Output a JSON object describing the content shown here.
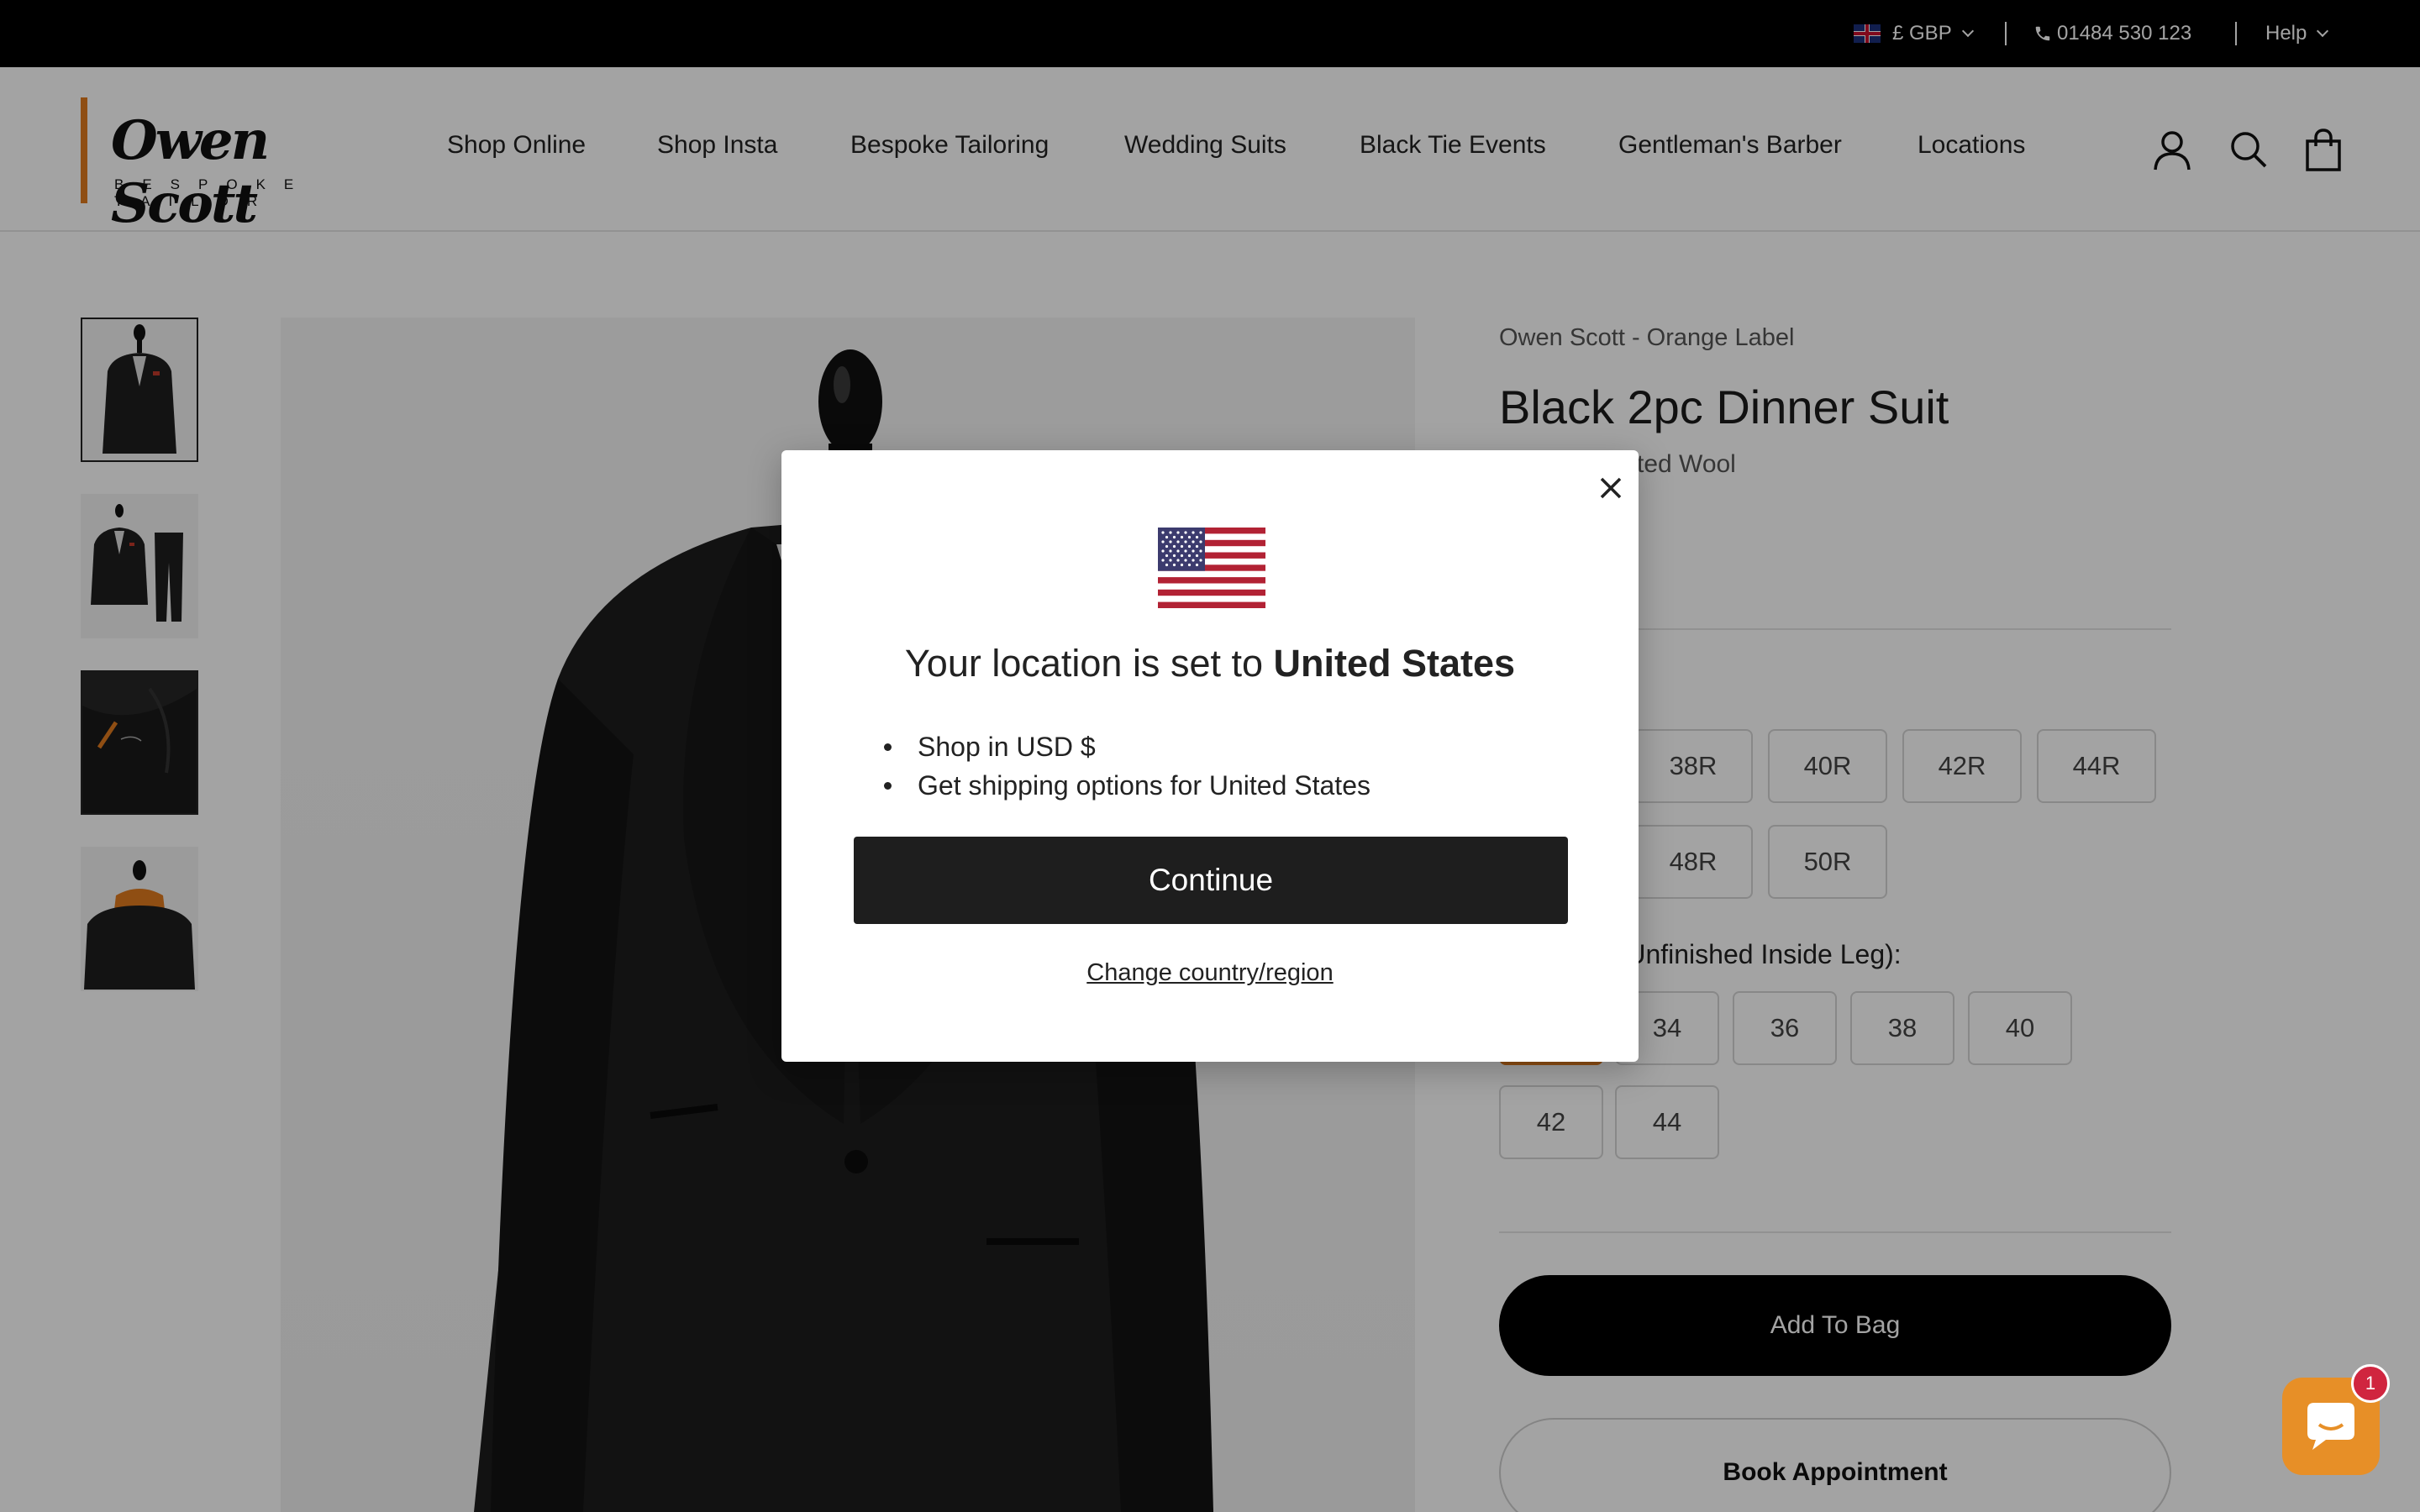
{
  "topbar": {
    "currency": "£ GBP",
    "phone": "01484 530 123",
    "help": "Help"
  },
  "brand": {
    "logo_name": "Owen Scott",
    "logo_sub": "BESPOKE TAILOR",
    "accent": "#e07a1f"
  },
  "nav": {
    "items": [
      {
        "label": "Shop Online"
      },
      {
        "label": "Shop Insta"
      },
      {
        "label": "Bespoke Tailoring"
      },
      {
        "label": "Wedding Suits"
      },
      {
        "label": "Black Tie Events"
      },
      {
        "label": "Gentleman's Barber"
      },
      {
        "label": "Locations"
      }
    ],
    "icons": [
      "account-icon",
      "search-icon",
      "bag-icon"
    ]
  },
  "product": {
    "vendor": "Owen Scott - Orange Label",
    "title": "Black 2pc Dinner Suit",
    "subtitle_visible": "ted Wool",
    "jacket_label_visible": ":",
    "jacket_sizes_row1": [
      "38R",
      "40R",
      "42R",
      "44R"
    ],
    "jacket_sizes_row2": [
      "48R",
      "50R"
    ],
    "leg_label_visible": "e (Unfinished Inside Leg):",
    "leg_sizes_row1": [
      "34",
      "36",
      "38",
      "40"
    ],
    "leg_sizes_row2": [
      "42",
      "44"
    ],
    "add_to_bag": "Add To Bag",
    "book_appointment": "Book Appointment"
  },
  "chat": {
    "badge": "1",
    "color": "#e78f27"
  },
  "modal": {
    "heading_prefix": "Your location is set to ",
    "heading_country": "United States",
    "bullets": [
      "Shop in USD $",
      "Get shipping options for United States"
    ],
    "continue_label": "Continue",
    "change_label": "Change country/region",
    "flag_icon": "us-flag-icon"
  }
}
